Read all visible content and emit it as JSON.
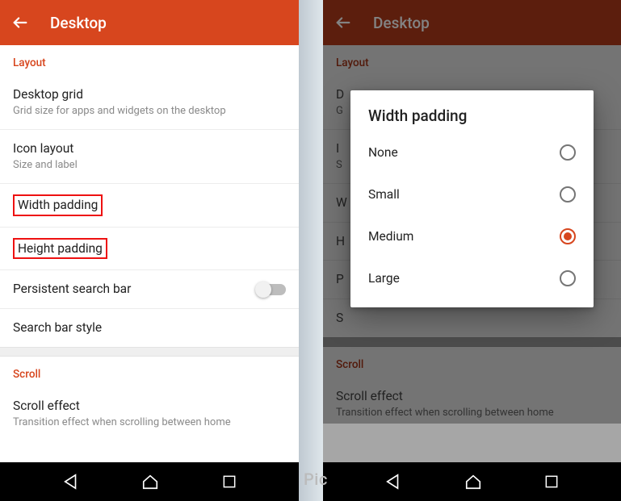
{
  "left": {
    "header_title": "Desktop",
    "sections": {
      "layout_label": "Layout",
      "scroll_label": "Scroll"
    },
    "rows": {
      "desktop_grid": {
        "title": "Desktop grid",
        "sub": "Grid size for apps and widgets on the desktop"
      },
      "icon_layout": {
        "title": "Icon layout",
        "sub": "Size and label"
      },
      "width_padding": {
        "title": "Width padding"
      },
      "height_padding": {
        "title": "Height padding"
      },
      "persistent_search": {
        "title": "Persistent search bar"
      },
      "search_bar_style": {
        "title": "Search bar style"
      },
      "scroll_effect": {
        "title": "Scroll effect",
        "sub": "Transition effect when scrolling between home"
      }
    }
  },
  "right": {
    "header_title": "Desktop",
    "sections": {
      "layout_label": "Layout",
      "scroll_label": "Scroll"
    },
    "rows": {
      "desktop_grid_initial": "D",
      "desktop_grid_sub_initial": "G",
      "icon_layout_initial": "I",
      "icon_layout_sub_initial": "S",
      "width_padding_initial": "W",
      "height_padding_initial": "H",
      "persistent_initial": "P",
      "search_style_initial": "S",
      "scroll_effect": {
        "title": "Scroll effect",
        "sub": "Transition effect when scrolling between home"
      }
    },
    "dialog": {
      "title": "Width padding",
      "options": [
        {
          "label": "None",
          "selected": false
        },
        {
          "label": "Small",
          "selected": false
        },
        {
          "label": "Medium",
          "selected": true
        },
        {
          "label": "Large",
          "selected": false
        }
      ]
    }
  },
  "watermark": "Pic"
}
